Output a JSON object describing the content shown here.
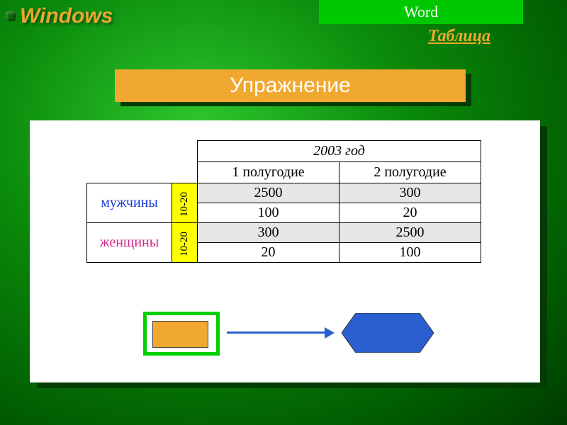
{
  "header": {
    "title": "Windows",
    "banner": "Word",
    "link": "Таблица"
  },
  "exercise_label": "Упражнение",
  "table": {
    "year_header": "2003 год",
    "half1": "1 полугодие",
    "half2": "2 полугодие",
    "rows": [
      {
        "category": "мужчины",
        "age": "10-20",
        "r1c1": "2500",
        "r1c2": "300",
        "r2c1": "100",
        "r2c2": "20"
      },
      {
        "category": "женщины",
        "age": "10-20",
        "r1c1": "300",
        "r1c2": "2500",
        "r2c1": "20",
        "r2c2": "100"
      }
    ]
  },
  "shapes": {
    "rect_color": "#f0a830",
    "rect_border": "#00d000",
    "arrow_color": "#2a5fd0",
    "hex_fill": "#2a5fd0"
  }
}
